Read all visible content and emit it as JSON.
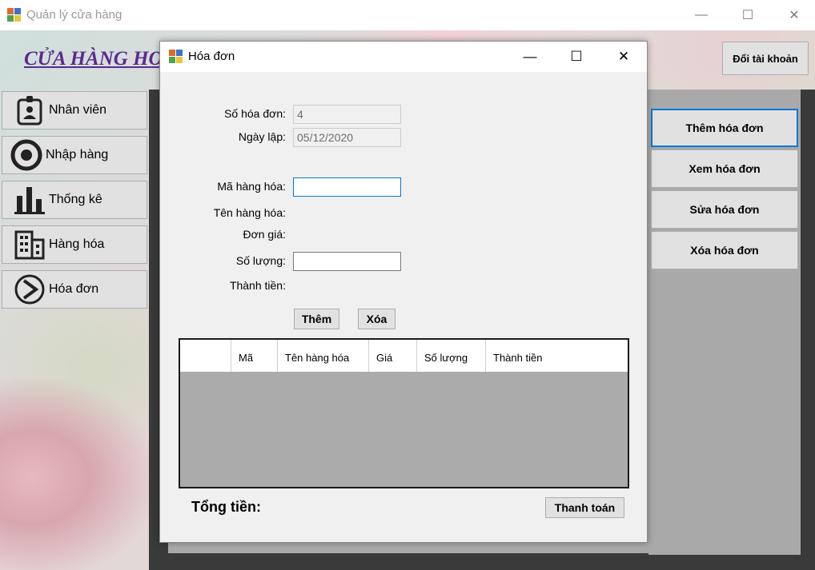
{
  "main_window": {
    "title": "Quản lý cửa hàng",
    "controls": {
      "minimize": "—",
      "maximize": "☐",
      "close": "✕"
    }
  },
  "main": {
    "shop_title": "CỬA HÀNG HOA",
    "switch_account_label": "Đổi tài khoản",
    "sidebar": [
      {
        "label": "Nhân viên",
        "icon": "employee-badge-icon"
      },
      {
        "label": "Nhập hàng",
        "icon": "import-target-icon"
      },
      {
        "label": "Thống kê",
        "icon": "bar-chart-icon"
      },
      {
        "label": "Hàng hóa",
        "icon": "building-icon"
      },
      {
        "label": "Hóa đơn",
        "icon": "invoice-arrow-icon"
      }
    ],
    "actions": [
      {
        "label": "Thêm hóa đơn",
        "focused": true
      },
      {
        "label": "Xem hóa đơn",
        "focused": false
      },
      {
        "label": "Sửa hóa đơn",
        "focused": false
      },
      {
        "label": "Xóa hóa đơn",
        "focused": false
      }
    ]
  },
  "dialog": {
    "title": "Hóa đơn",
    "controls": {
      "minimize": "—",
      "maximize": "☐",
      "close": "✕"
    },
    "fields": {
      "invoice_no_label": "Số hóa đơn:",
      "invoice_no_value": "4",
      "date_label": "Ngày lập:",
      "date_value": "05/12/2020",
      "product_code_label": "Mã hàng hóa:",
      "product_code_value": "",
      "product_name_label": "Tên hàng hóa:",
      "unit_price_label": "Đơn giá:",
      "quantity_label": "Số lượng:",
      "quantity_value": "",
      "amount_label": "Thành tiền:"
    },
    "add_label": "Thêm",
    "delete_label": "Xóa",
    "grid_columns": [
      "",
      "Mã",
      "Tên hàng hóa",
      "Giá",
      "Số lượng",
      "Thành tiền"
    ],
    "total_label": "Tổng tiền:",
    "pay_label": "Thanh toán"
  },
  "colors": {
    "title_purple": "#5b2a8f",
    "focus_blue": "#0078d7",
    "button_gray": "#e1e1e1",
    "panel_gray": "#a9a9a9",
    "panel_dark": "#3a3a3a"
  }
}
